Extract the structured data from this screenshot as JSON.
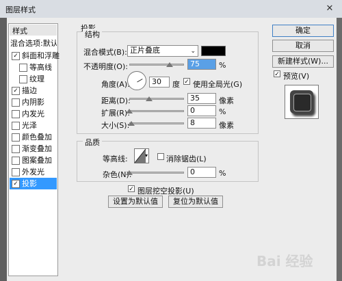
{
  "window": {
    "title": "图层样式",
    "close": "✕"
  },
  "left_panel": {
    "header": "样式",
    "blend_options": "混合选项:默认",
    "items": [
      {
        "label": "斜面和浮雕",
        "checked": true
      },
      {
        "label": "等高线",
        "checked": false
      },
      {
        "label": "纹理",
        "checked": false
      },
      {
        "label": "描边",
        "checked": true
      },
      {
        "label": "内阴影",
        "checked": false
      },
      {
        "label": "内发光",
        "checked": false
      },
      {
        "label": "光泽",
        "checked": false
      },
      {
        "label": "颜色叠加",
        "checked": false
      },
      {
        "label": "渐变叠加",
        "checked": false
      },
      {
        "label": "图案叠加",
        "checked": false
      },
      {
        "label": "外发光",
        "checked": false
      },
      {
        "label": "投影",
        "checked": true,
        "selected": true
      }
    ]
  },
  "drop_shadow": {
    "section_title": "投影",
    "structure": {
      "title": "结构",
      "blend_mode_label": "混合模式(B):",
      "blend_mode_value": "正片叠底",
      "blend_color": "#000000",
      "opacity_label": "不透明度(O):",
      "opacity_value": "75",
      "opacity_unit": "%",
      "angle_label": "角度(A):",
      "angle_value": "30",
      "angle_unit": "度",
      "global_light_label": "使用全局光(G)",
      "global_light_checked": "✓",
      "distance_label": "距离(D):",
      "distance_value": "35",
      "distance_unit": "像素",
      "spread_label": "扩展(R):",
      "spread_value": "0",
      "spread_unit": "%",
      "size_label": "大小(S):",
      "size_value": "8",
      "size_unit": "像素"
    },
    "quality": {
      "title": "品质",
      "contour_label": "等高线:",
      "antialias_label": "消除锯齿(L)",
      "noise_label": "杂色(N):",
      "noise_value": "0",
      "noise_unit": "%"
    },
    "knockout_label": "图层挖空投影(U)",
    "knockout_checked": "✓",
    "set_default": "设置为默认值",
    "reset_default": "复位为默认值"
  },
  "buttons": {
    "ok": "确定",
    "cancel": "取消",
    "new_style": "新建样式(W)...",
    "preview_label": "预览(V)",
    "preview_checked": "✓"
  },
  "watermark": "Bai 经验"
}
